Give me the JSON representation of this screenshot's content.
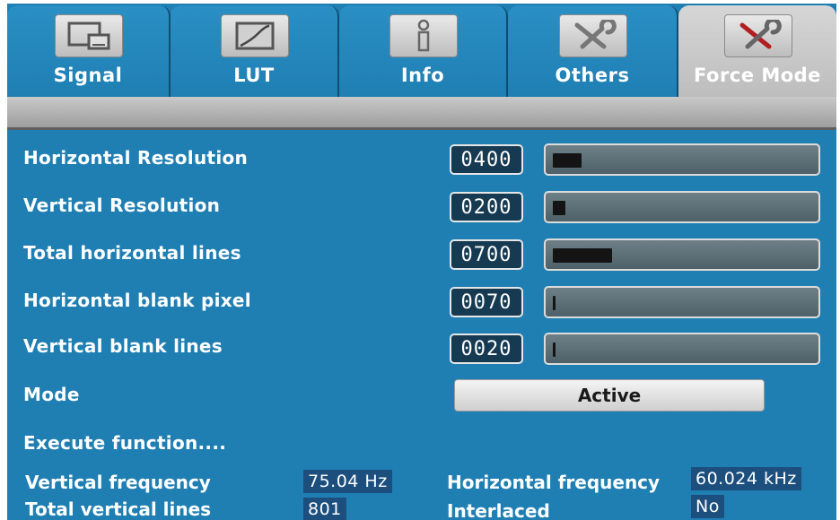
{
  "tabs": [
    {
      "label": "Signal",
      "icon": "monitor-icon",
      "active": false
    },
    {
      "label": "LUT",
      "icon": "lut-panel-icon",
      "active": false
    },
    {
      "label": "Info",
      "icon": "info-icon",
      "active": false
    },
    {
      "label": "Others",
      "icon": "tools-icon",
      "active": false
    },
    {
      "label": "Force Mode",
      "icon": "tools-icon",
      "active": true
    }
  ],
  "rows": [
    {
      "label": "Horizontal Resolution",
      "value": "0400",
      "level": 0.11
    },
    {
      "label": "Vertical Resolution",
      "value": "0200",
      "level": 0.05
    },
    {
      "label": "Total horizontal lines",
      "value": "0700",
      "level": 0.23
    },
    {
      "label": "Horizontal blank pixel",
      "value": "0070",
      "level": 0.01
    },
    {
      "label": "Vertical blank lines",
      "value": "0020",
      "level": 0.0
    }
  ],
  "mode": {
    "label": "Mode",
    "value": "Active"
  },
  "execute_label": "Execute function....",
  "info": {
    "vertical_frequency_label": "Vertical frequency",
    "vertical_frequency_value": "75.04 Hz",
    "horizontal_frequency_label": "Horizontal frequency",
    "horizontal_frequency_value": "60.024 kHz",
    "total_vertical_lines_label": "Total vertical lines",
    "total_vertical_lines_value": "801",
    "interlaced_label": "Interlaced",
    "interlaced_value": "No"
  },
  "colors": {
    "background": "#1f7fb3",
    "active_tab": "#c9c9c9",
    "slider_fill": "#141414"
  }
}
